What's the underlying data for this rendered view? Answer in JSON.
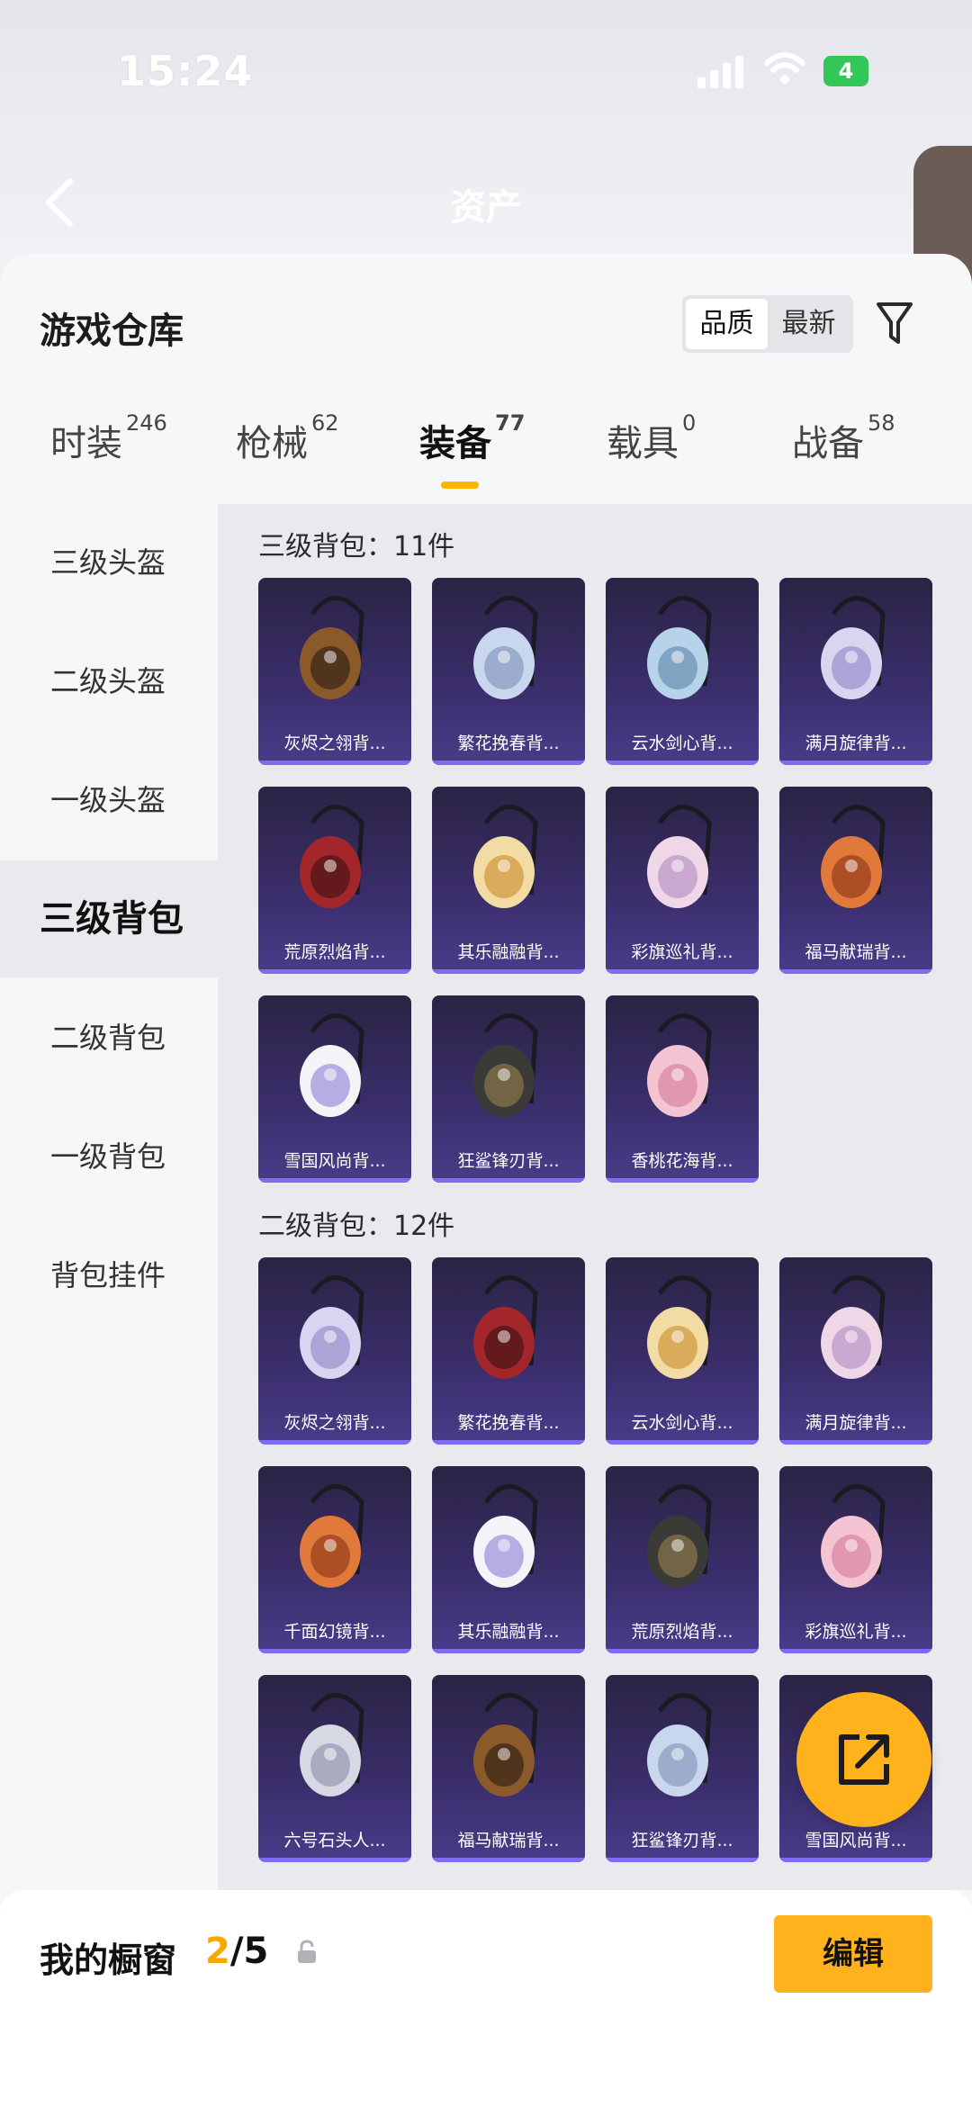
{
  "status_bar": {
    "time": "15:24",
    "battery": "4"
  },
  "nav": {
    "title": "资产"
  },
  "header": {
    "title": "游戏仓库",
    "sort_options": [
      "品质",
      "最新"
    ]
  },
  "tabs": [
    {
      "label": "时装",
      "count": "246"
    },
    {
      "label": "枪械",
      "count": "62"
    },
    {
      "label": "装备",
      "count": "77"
    },
    {
      "label": "载具",
      "count": "0"
    },
    {
      "label": "战备",
      "count": "58"
    }
  ],
  "sidebar": {
    "items": [
      "三级头盔",
      "二级头盔",
      "一级头盔",
      "三级背包",
      "二级背包",
      "一级背包",
      "背包挂件"
    ]
  },
  "sections": [
    {
      "title": "三级背包：11件",
      "items": [
        "灰烬之翎背...",
        "繁花挽春背...",
        "云水剑心背...",
        "满月旋律背...",
        "荒原烈焰背...",
        "其乐融融背...",
        "彩旗巡礼背...",
        "福马献瑞背...",
        "雪国风尚背...",
        "狂鲨锋刃背...",
        "香桃花海背..."
      ]
    },
    {
      "title": "二级背包：12件",
      "items": [
        "灰烬之翎背...",
        "繁花挽春背...",
        "云水剑心背...",
        "满月旋律背...",
        "千面幻镜背...",
        "其乐融融背...",
        "荒原烈焰背...",
        "彩旗巡礼背...",
        "六号石头人...",
        "福马献瑞背...",
        "狂鲨锋刃背...",
        "雪国风尚背..."
      ]
    }
  ],
  "showcase": {
    "label": "我的橱窗",
    "current": "2",
    "total": "/5",
    "edit_label": "编辑"
  },
  "colors": {
    "accent": "#ffb21c",
    "card_bg": "#3b2e6c",
    "card_bar": "#7d6cf0"
  }
}
